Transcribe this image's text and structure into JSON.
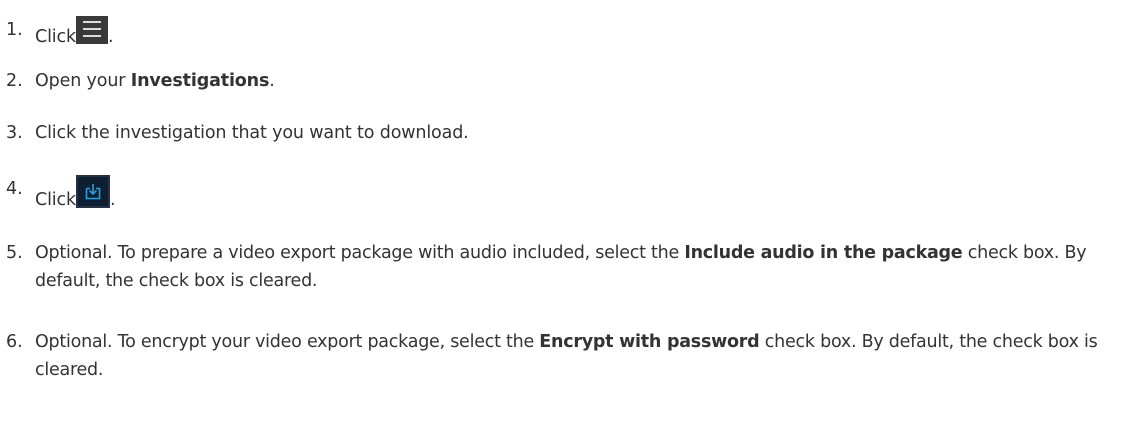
{
  "steps": [
    {
      "number": "1.",
      "before": "Click",
      "icon": "menu-icon",
      "after": "."
    },
    {
      "number": "2.",
      "before": "Open your ",
      "bold": "Investigations",
      "after": "."
    },
    {
      "number": "3.",
      "text": "Click the investigation that you want to download."
    },
    {
      "number": "4.",
      "before": "Click",
      "icon": "download-icon",
      "after": "."
    },
    {
      "number": "5.",
      "before": "Optional. To prepare a video export package with audio included, select the ",
      "bold": "Include audio in the package",
      "after": " check box. By default, the check box is cleared."
    },
    {
      "number": "6.",
      "before": "Optional. To encrypt your video export package, select the ",
      "bold": "Encrypt with password",
      "after": " check box. By default, the check box is cleared."
    }
  ],
  "colors": {
    "text": "#333333",
    "menu_button_bg": "#3a3a3a",
    "download_button_bg": "#0f1f33",
    "download_icon": "#2a9fd8"
  }
}
